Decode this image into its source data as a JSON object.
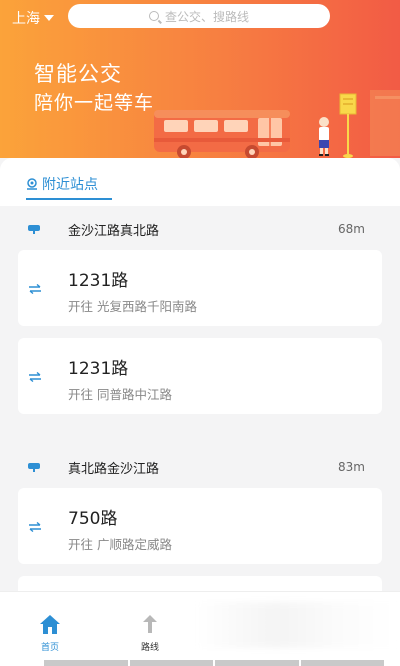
{
  "header": {
    "city": "上海",
    "search_placeholder": "查公交、搜路线",
    "slogan_line1": "智能公交",
    "slogan_line2": "陪你一起等车"
  },
  "tabs": {
    "nearby_label": "附近站点"
  },
  "stations": [
    {
      "name": "金沙江路真北路",
      "distance": "68m",
      "routes": [
        {
          "number": "1231路",
          "direction_prefix": "开往",
          "destination": "光复西路千阳南路"
        },
        {
          "number": "1231路",
          "direction_prefix": "开往",
          "destination": "同普路中江路"
        }
      ]
    },
    {
      "name": "真北路金沙江路",
      "distance": "83m",
      "routes": [
        {
          "number": "750路",
          "direction_prefix": "开往",
          "destination": "广顺路定威路"
        }
      ]
    }
  ],
  "bottom_nav": {
    "home_label": "首页",
    "route_label": "路线"
  },
  "colors": {
    "accent": "#2d8fd4",
    "hero_start": "#fba33a",
    "hero_end": "#f25b45"
  }
}
